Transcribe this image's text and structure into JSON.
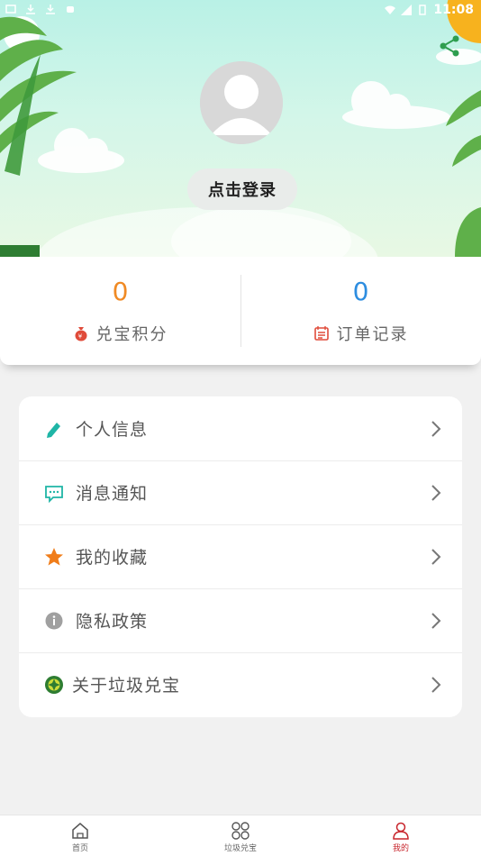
{
  "statusbar": {
    "time": "11:08"
  },
  "header": {
    "login_label": "点击登录"
  },
  "stats": [
    {
      "value": "0",
      "label": "兑宝积分",
      "color": "#f08a24"
    },
    {
      "value": "0",
      "label": "订单记录",
      "color": "#2d8de0"
    }
  ],
  "menu": {
    "items": [
      {
        "label": "个人信息",
        "icon": "pencil-icon"
      },
      {
        "label": "消息通知",
        "icon": "message-icon"
      },
      {
        "label": "我的收藏",
        "icon": "star-icon"
      },
      {
        "label": "隐私政策",
        "icon": "info-icon"
      },
      {
        "label": "关于垃圾兑宝",
        "icon": "app-logo-icon"
      }
    ]
  },
  "bottom_nav": {
    "items": [
      {
        "label": "首页",
        "icon": "home-icon"
      },
      {
        "label": "垃圾兑宝",
        "icon": "grid-icon"
      },
      {
        "label": "我的",
        "icon": "user-icon",
        "active": true
      }
    ],
    "active_color": "#c8252c"
  }
}
